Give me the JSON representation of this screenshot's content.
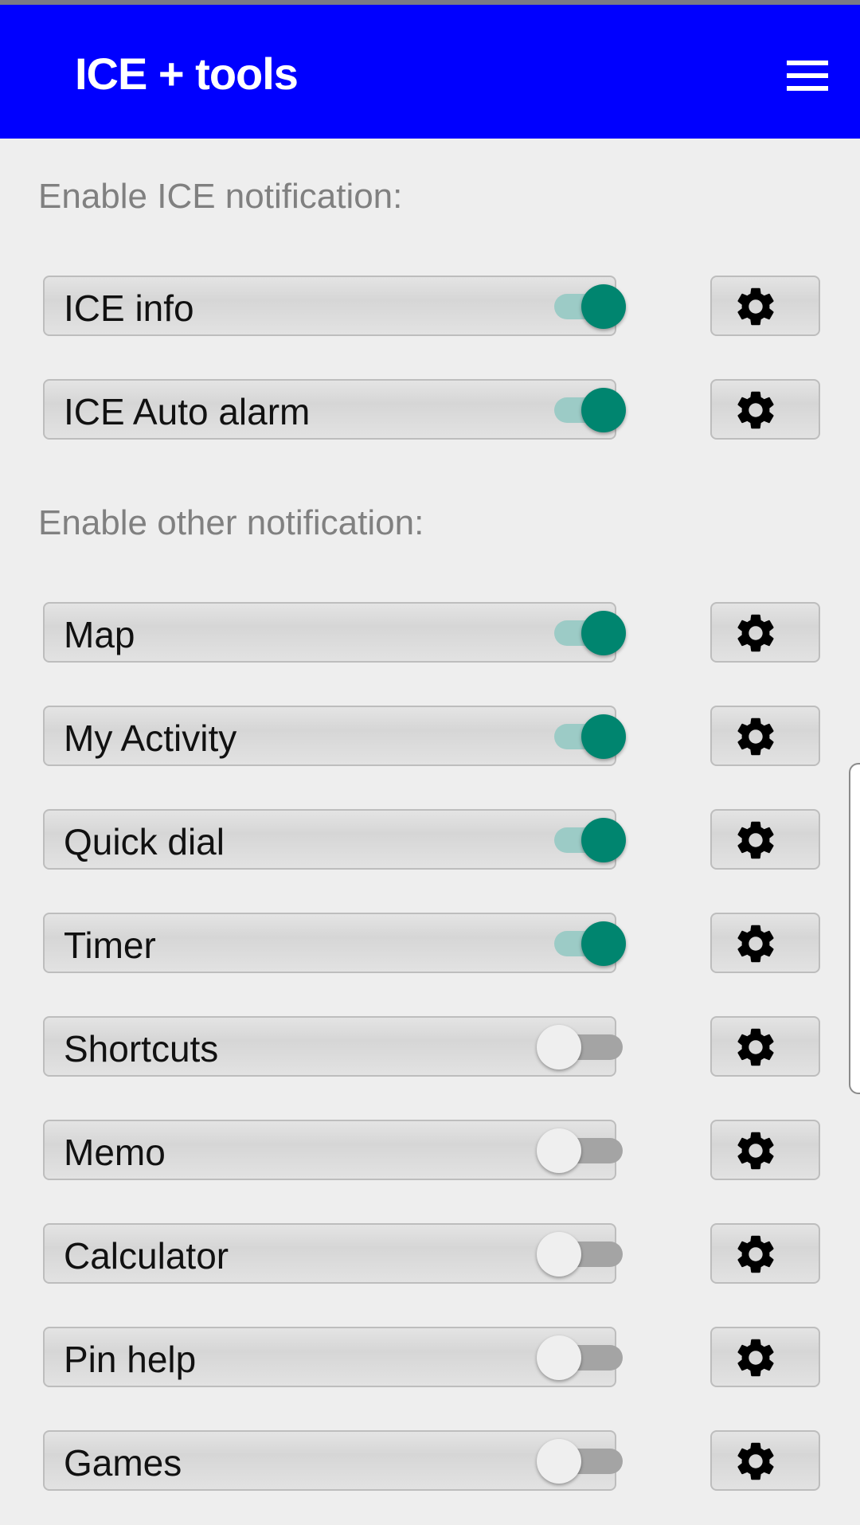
{
  "app": {
    "title": "ICE + tools"
  },
  "icons": {
    "menu": "hamburger-menu-icon",
    "settings": "gear-icon"
  },
  "colors": {
    "appbar": "#0000ff",
    "switch_on": "#00856f",
    "switch_on_track": "#9ccbc6",
    "switch_off_track": "#a4a4a4"
  },
  "sections": [
    {
      "heading": "Enable ICE notification:",
      "items": [
        {
          "label": "ICE info",
          "enabled": true
        },
        {
          "label": "ICE Auto alarm",
          "enabled": true
        }
      ]
    },
    {
      "heading": "Enable other notification:",
      "items": [
        {
          "label": "Map",
          "enabled": true
        },
        {
          "label": "My Activity",
          "enabled": true
        },
        {
          "label": "Quick dial",
          "enabled": true
        },
        {
          "label": "Timer",
          "enabled": true
        },
        {
          "label": "Shortcuts",
          "enabled": false
        },
        {
          "label": "Memo",
          "enabled": false
        },
        {
          "label": "Calculator",
          "enabled": false
        },
        {
          "label": "Pin help",
          "enabled": false
        },
        {
          "label": "Games",
          "enabled": false
        }
      ]
    }
  ]
}
